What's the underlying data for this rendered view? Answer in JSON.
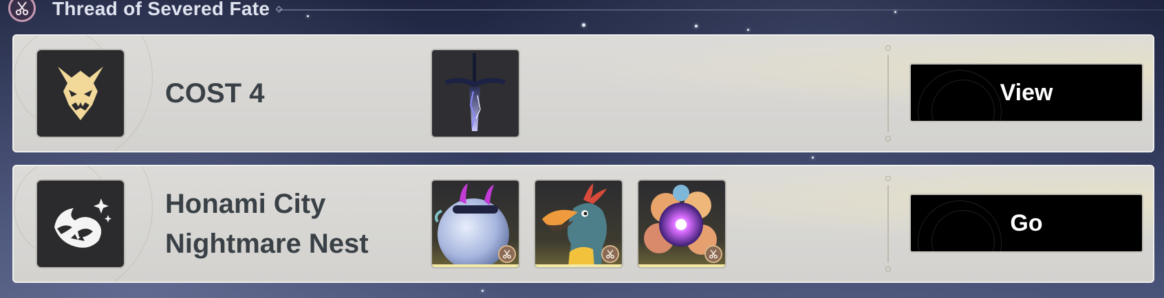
{
  "section": {
    "title": "Thread of Severed Fate",
    "icon": "scissors-icon"
  },
  "rows": [
    {
      "type_icon": "demon-mask-icon",
      "title_line1": "COST 4",
      "title_line2": "",
      "thumbnails": [
        {
          "icon": "dark-sword-item-icon",
          "badge": false
        }
      ],
      "action_label": "View"
    },
    {
      "type_icon": "nightmare-beast-icon",
      "title_line1": "Honami City",
      "title_line2": "Nightmare Nest",
      "thumbnails": [
        {
          "icon": "horned-orb-creature-icon",
          "badge": true
        },
        {
          "icon": "toucan-bird-creature-icon",
          "badge": true
        },
        {
          "icon": "flower-orb-creature-icon",
          "badge": true
        }
      ],
      "action_label": "Go"
    }
  ],
  "colors": {
    "row_bg": "#d6d5d2",
    "button_bg": "#000000",
    "title_text": "#3a4146",
    "header_text": "#dfe3ef",
    "badge_ring": "#c99ab4"
  }
}
